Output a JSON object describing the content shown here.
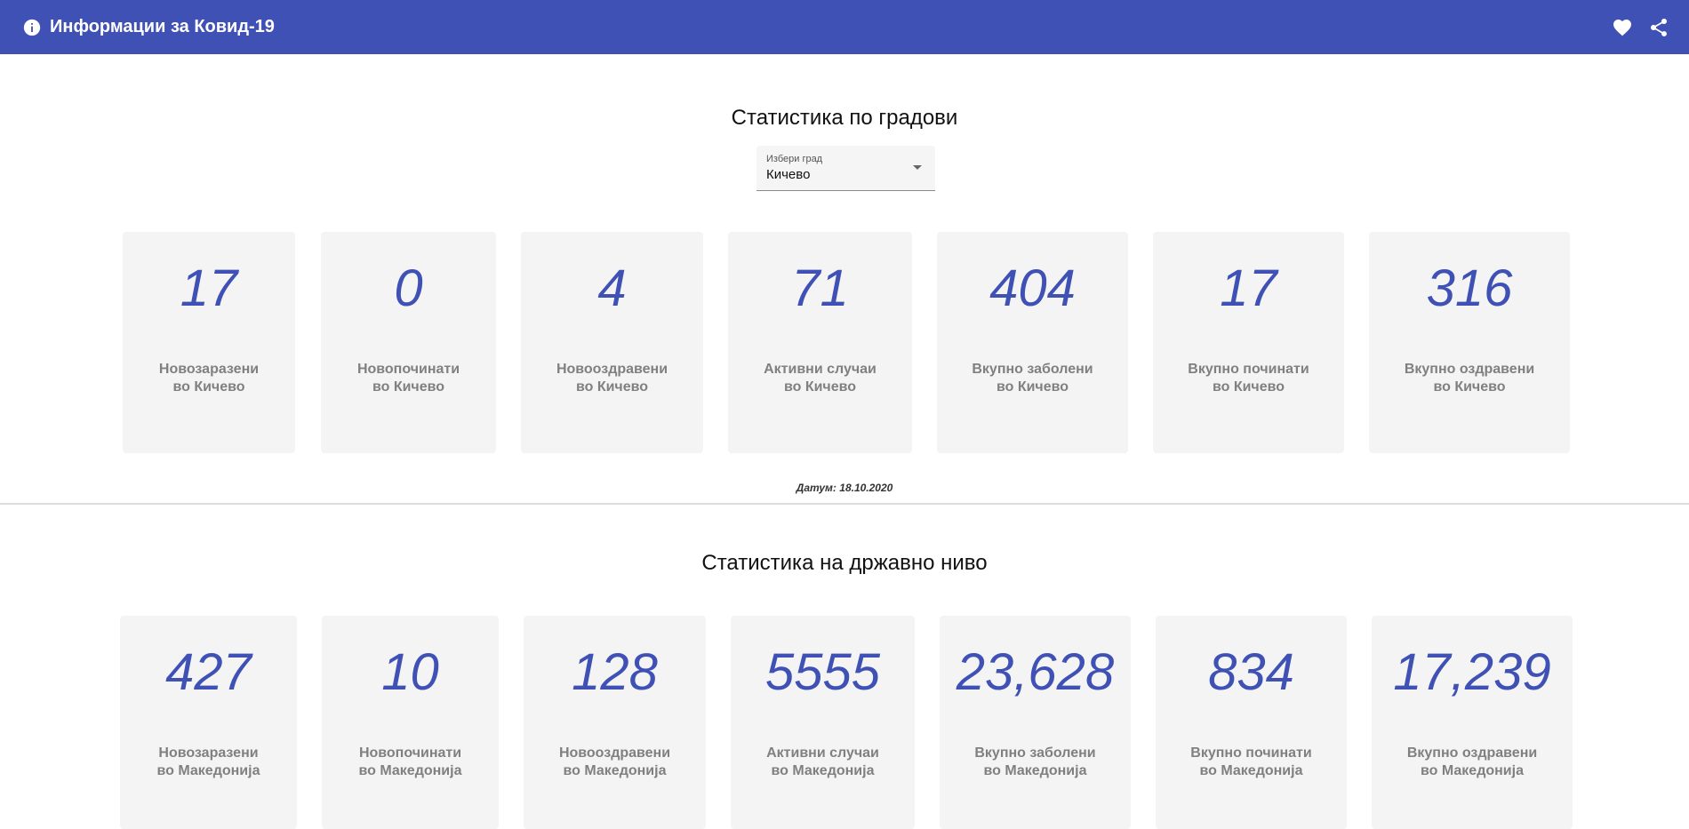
{
  "header": {
    "title": "Информации за Ковид-19",
    "icons": [
      "info-icon",
      "heart-icon",
      "share-icon"
    ],
    "bg_color": "#3f51b5"
  },
  "city_section": {
    "title": "Статистика по градови",
    "select": {
      "label": "Избери град",
      "value": "Кичево"
    },
    "cards": [
      {
        "value": "17",
        "line1": "Новозаразени",
        "line2": "во Кичево"
      },
      {
        "value": "0",
        "line1": "Новопочинати",
        "line2": "во Кичево"
      },
      {
        "value": "4",
        "line1": "Новооздравени",
        "line2": "во Кичево"
      },
      {
        "value": "71",
        "line1": "Активни случаи",
        "line2": "во Кичево"
      },
      {
        "value": "404",
        "line1": "Вкупно заболени",
        "line2": "во Кичево"
      },
      {
        "value": "17",
        "line1": "Вкупно починати",
        "line2": "во Кичево"
      },
      {
        "value": "316",
        "line1": "Вкупно оздравени",
        "line2": "во Кичево"
      }
    ],
    "date": "Датум: 18.10.2020"
  },
  "country_section": {
    "title": "Статистика на државно ниво",
    "cards": [
      {
        "value": "427",
        "line1": "Новозаразени",
        "line2": "во Македонија"
      },
      {
        "value": "10",
        "line1": "Новопочинати",
        "line2": "во Македонија"
      },
      {
        "value": "128",
        "line1": "Новооздравени",
        "line2": "во Македонија"
      },
      {
        "value": "5555",
        "line1": "Активни случаи",
        "line2": "во Македонија"
      },
      {
        "value": "23,628",
        "line1": "Вкупно заболени",
        "line2": "во Македонија"
      },
      {
        "value": "834",
        "line1": "Вкупно починати",
        "line2": "во Македонија"
      },
      {
        "value": "17,239",
        "line1": "Вкупно оздравени",
        "line2": "во Македонија"
      }
    ]
  },
  "colors": {
    "accent": "#3f51b5",
    "card_bg": "#f4f4f4",
    "label_gray": "#808080"
  }
}
